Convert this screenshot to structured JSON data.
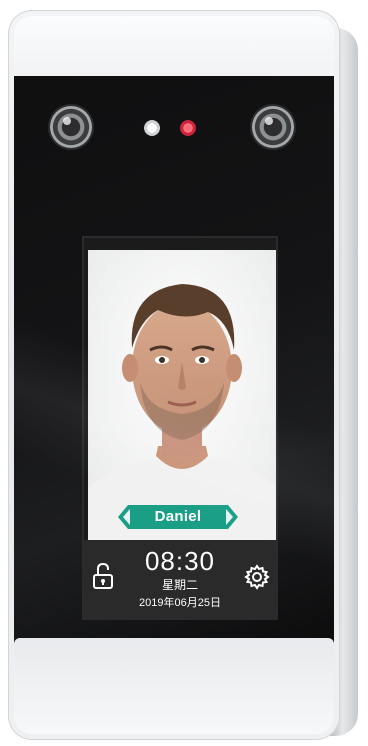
{
  "device": {
    "person_name": "Daniel",
    "time": "08:30",
    "weekday": "星期二",
    "date": "2019年06月25日",
    "icons": {
      "lock": "unlock-icon",
      "settings": "gear-icon"
    },
    "colors": {
      "accent": "#1a9e86",
      "led_white": "#f2f2f2",
      "led_red": "#e2334b"
    }
  }
}
